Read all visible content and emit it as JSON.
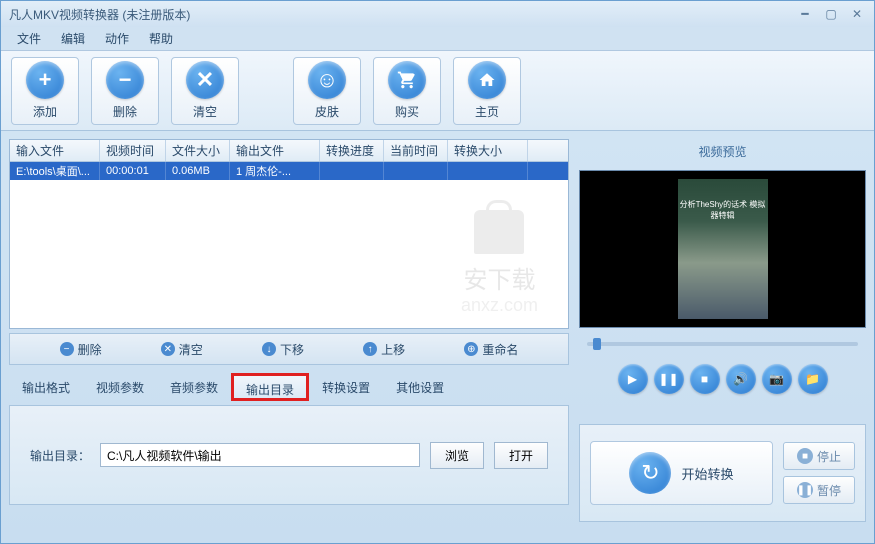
{
  "titlebar": {
    "title": "凡人MKV视频转换器   (未注册版本)"
  },
  "menubar": {
    "items": [
      "文件",
      "编辑",
      "动作",
      "帮助"
    ]
  },
  "toolbar": {
    "add": "添加",
    "delete": "删除",
    "clear": "清空",
    "skin": "皮肤",
    "buy": "购买",
    "home": "主页"
  },
  "table": {
    "headers": [
      "输入文件",
      "视频时间",
      "文件大小",
      "输出文件",
      "转换进度",
      "当前时间",
      "转换大小"
    ],
    "row": {
      "input_file": "E:\\tools\\桌面\\...",
      "video_time": "00:00:01",
      "file_size": "0.06MB",
      "output_file": "1 周杰伦-...",
      "progress": "",
      "current_time": "",
      "convert_size": ""
    }
  },
  "watermark": {
    "text1": "安下载",
    "text2": "anxz.com"
  },
  "list_actions": {
    "delete": "删除",
    "clear": "清空",
    "down": "下移",
    "up": "上移",
    "rename": "重命名"
  },
  "tabs": {
    "items": [
      "输出格式",
      "视频参数",
      "音频参数",
      "输出目录",
      "转换设置",
      "其他设置"
    ],
    "active_index": 3
  },
  "output": {
    "label": "输出目录：",
    "path": "C:\\凡人视频软件\\输出",
    "browse": "浏览",
    "open": "打开"
  },
  "preview": {
    "title": "视频预览",
    "caption": "分析TheShy的话术\n模拟器特辑"
  },
  "convert": {
    "start": "开始转换",
    "stop": "停止",
    "pause": "暂停"
  }
}
